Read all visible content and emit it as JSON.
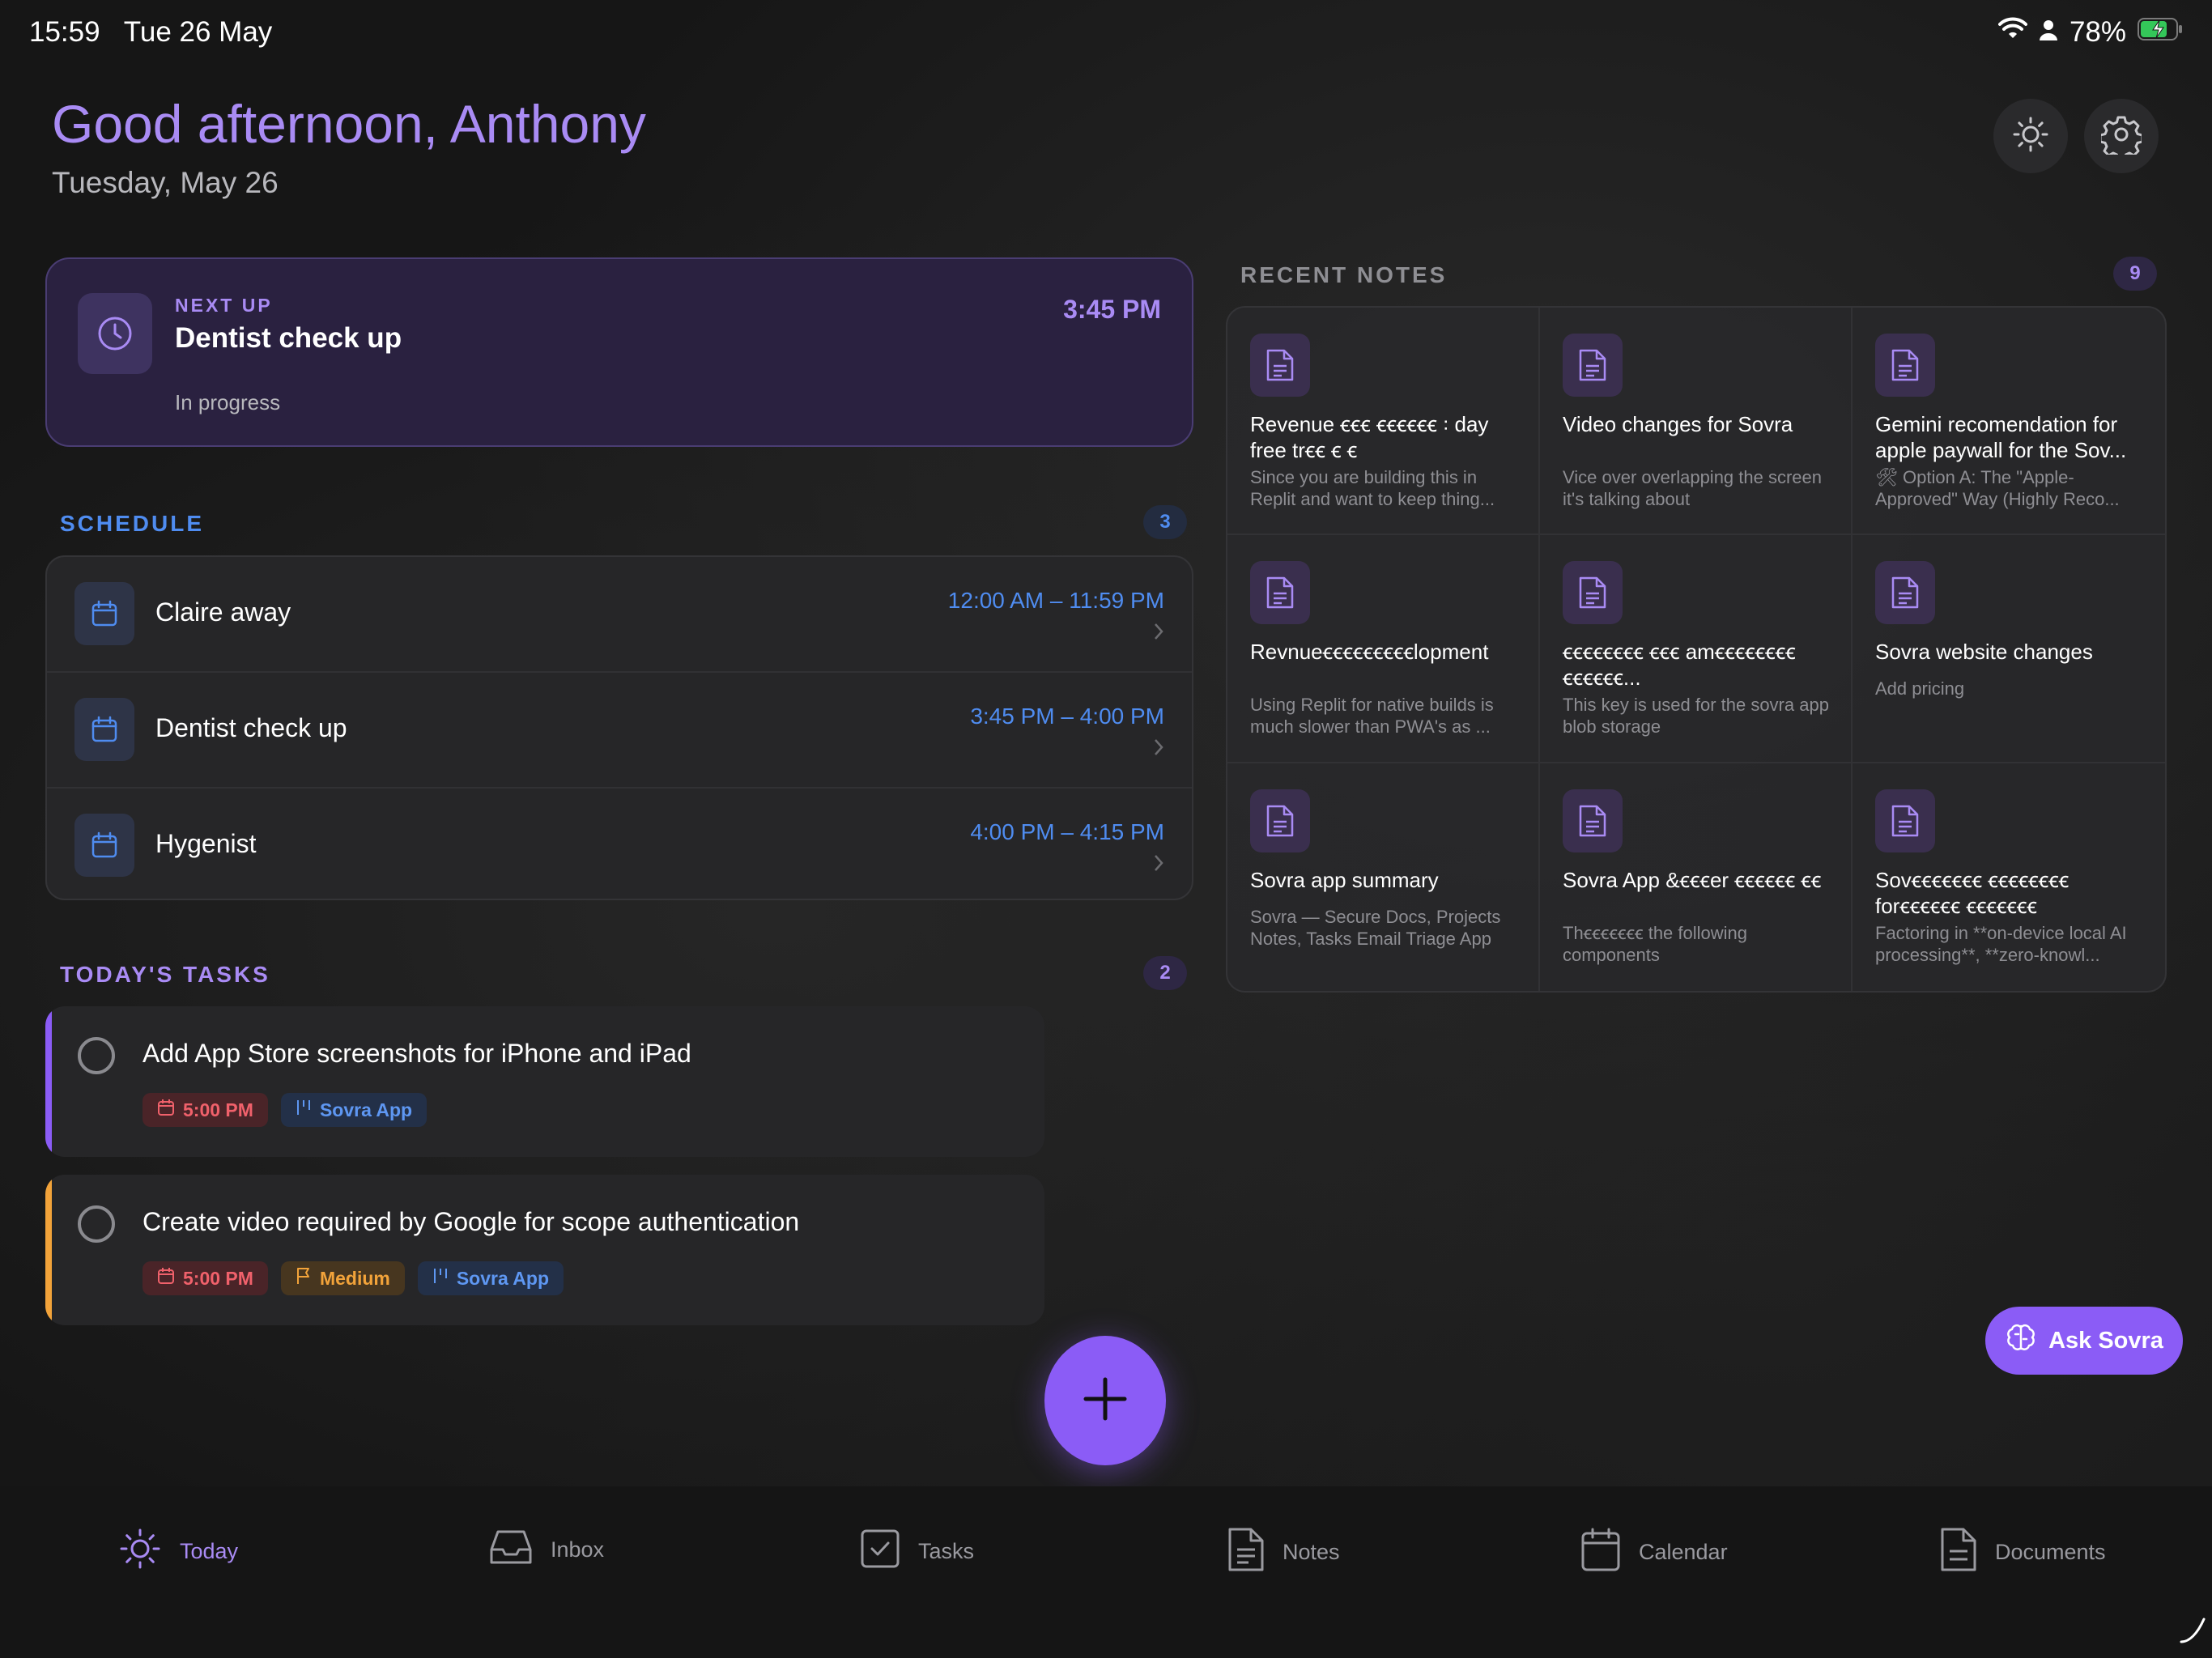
{
  "status_bar": {
    "time": "15:59",
    "date": "Tue 26 May",
    "battery": "78%"
  },
  "header": {
    "greeting": "Good afternoon, Anthony",
    "date": "Tuesday, May 26",
    "theme_icon": "sun-icon",
    "settings_icon": "gear-icon"
  },
  "next_up": {
    "label": "NEXT UP",
    "title": "Dentist check up",
    "time": "3:45 PM",
    "status": "In progress"
  },
  "schedule": {
    "title": "SCHEDULE",
    "count": "3",
    "items": [
      {
        "title": "Claire away",
        "time": "12:00 AM – 11:59 PM"
      },
      {
        "title": "Dentist check up",
        "time": "3:45 PM – 4:00 PM"
      },
      {
        "title": "Hygenist",
        "time": "4:00 PM – 4:15 PM"
      }
    ]
  },
  "tasks": {
    "title": "TODAY'S TASKS",
    "count": "2",
    "items": [
      {
        "title": "Add App Store screenshots for iPhone and iPad",
        "due": "5:00 PM",
        "priority": "",
        "project": "Sovra App",
        "accent": "#8b5cf6"
      },
      {
        "title": "Create video required by Google for scope authentication",
        "due": "5:00 PM",
        "priority": "Medium",
        "project": "Sovra App",
        "accent": "#f2a33a"
      }
    ]
  },
  "notes": {
    "title": "RECENT NOTES",
    "count": "9",
    "items": [
      {
        "title": "Revenue ꞓꞓꞓ ꞓꞓꞓꞓꞓꞓ ꞉ day free trꞓꞓ ꞓ ꞓ",
        "preview": "Since you are building this in Replit and want to keep thing..."
      },
      {
        "title": "Video changes for Sovra",
        "preview": "Vice over overlapping the screen it's talking about"
      },
      {
        "title": "Gemini recomendation  for apple paywall for the Sov...",
        "preview": "🛠 Option A: The \"Apple-Approved\" Way (Highly Reco..."
      },
      {
        "title": "Revnueꞓꞓꞓꞓꞓꞓꞓꞓꞓlopment",
        "preview": "Using Replit for native builds is much slower than PWA's as ..."
      },
      {
        "title": "ꞓꞓꞓꞓꞓꞓꞓꞓ ꞓꞓꞓ amꞓꞓꞓꞓꞓꞓꞓꞓ ꞓꞓꞓꞓꞓꞓ...",
        "preview": "This key is used for the  sovra app blob storage"
      },
      {
        "title": "Sovra website changes",
        "preview": "Add pricing"
      },
      {
        "title": "Sovra app summary",
        "preview": "Sovra — Secure Docs, Projects Notes, Tasks Email Triage App"
      },
      {
        "title": "Sovra App &ꞓꞓꞓer ꞓꞓꞓꞓꞓꞓ ꞓꞓ",
        "preview": "Thꞓꞓꞓꞓꞓꞓꞓ the following components"
      },
      {
        "title": "Sovꞓꞓꞓꞓꞓꞓꞓ ꞓꞓꞓꞓꞓꞓꞓꞓ forꞓꞓꞓꞓꞓꞓ ꞓꞓꞓꞓꞓꞓꞓ",
        "preview": "Factoring in **on-device local AI processing**, **zero-knowl..."
      }
    ]
  },
  "ask_button": "Ask Sovra",
  "tabbar": {
    "items": [
      {
        "label": "Today",
        "icon": "sun-icon",
        "active": true
      },
      {
        "label": "Inbox",
        "icon": "inbox-icon",
        "active": false
      },
      {
        "label": "Tasks",
        "icon": "checkbox-icon",
        "active": false
      },
      {
        "label": "Notes",
        "icon": "note-icon",
        "active": false
      },
      {
        "label": "Calendar",
        "icon": "calendar-icon",
        "active": false
      },
      {
        "label": "Documents",
        "icon": "document-icon",
        "active": false
      }
    ]
  },
  "colors": {
    "accent": "#8b5cf6",
    "accent_text": "#a98bf4",
    "schedule_blue": "#4f8cf0",
    "due_red": "#f0616b",
    "priority_orange": "#f2a33a"
  }
}
